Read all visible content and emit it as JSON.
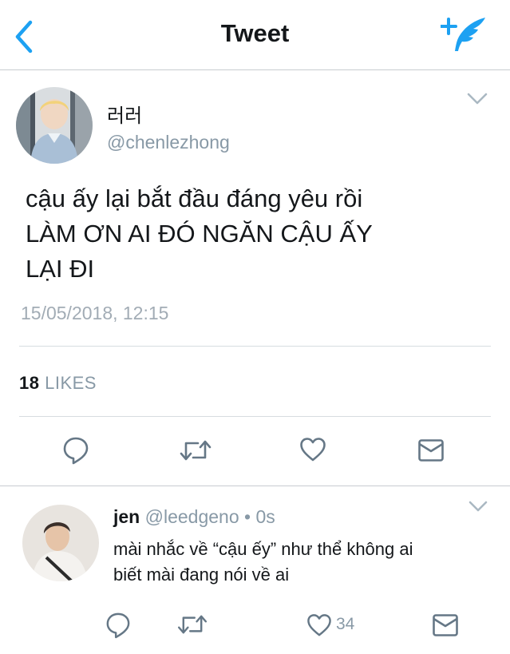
{
  "header": {
    "title": "Tweet",
    "back_icon": "chevron-left-icon",
    "compose_icon": "compose-tweet-icon",
    "accent_color": "#1da1f2"
  },
  "main_tweet": {
    "display_name": "러러",
    "handle": "@chenlezhong",
    "text_lines": [
      "cậu ấy lại bắt đầu đáng yêu rồi",
      "LÀM ƠN AI ĐÓ NGĂN CẬU ẤY",
      "LẠI ĐI"
    ],
    "timestamp": "15/05/2018, 12:15",
    "likes_count": "18",
    "likes_label": "LIKES",
    "actions": [
      "reply-icon",
      "retweet-icon",
      "like-icon",
      "direct-message-icon"
    ]
  },
  "reply_tweet": {
    "display_name": "jen",
    "handle": "@leedgeno",
    "separator": "•",
    "time": "0s",
    "text_lines": [
      "mài nhắc về “cậu ếy” như thể không ai",
      "biết mài đang nói về ai"
    ],
    "like_count": "34",
    "actions": [
      "reply-icon",
      "retweet-icon",
      "like-icon",
      "direct-message-icon"
    ]
  }
}
